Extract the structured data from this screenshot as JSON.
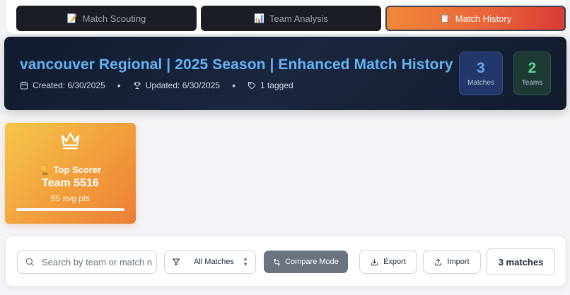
{
  "tabs": [
    {
      "label": "Match Scouting",
      "icon": "memo-icon",
      "glyph": "📝",
      "active": false
    },
    {
      "label": "Team Analysis",
      "icon": "bar-chart-icon",
      "glyph": "📊",
      "active": false
    },
    {
      "label": "Match History",
      "icon": "clipboard-icon",
      "glyph": "📋",
      "active": true
    }
  ],
  "header": {
    "title": "vancouver Regional | 2025 Season | Enhanced Match History",
    "created": "Created: 6/30/2025",
    "updated": "Updated: 6/30/2025",
    "tagged": "1 tagged",
    "separator": "•"
  },
  "stats": {
    "matches": {
      "value": "3",
      "label": "Matches"
    },
    "teams": {
      "value": "2",
      "label": "Teams"
    }
  },
  "top_scorer": {
    "label": "🏆 Top Scorer",
    "team": "Team 5516",
    "avg": "95 avg pts",
    "progress_percent": 100
  },
  "toolbar": {
    "search_placeholder": "Search by team or match number...",
    "filter_value": "All Matches",
    "compare_label": "Compare Mode",
    "export_label": "Export",
    "import_label": "Import",
    "count_label": "3 matches"
  },
  "colors": {
    "accent_orange": "#e8663a",
    "accent_red": "#db3b36",
    "title_blue": "#62b3f4",
    "matches_blue": "#6aa7f3",
    "teams_green": "#5bd98d",
    "scorer_gold": "#f6c64a"
  }
}
